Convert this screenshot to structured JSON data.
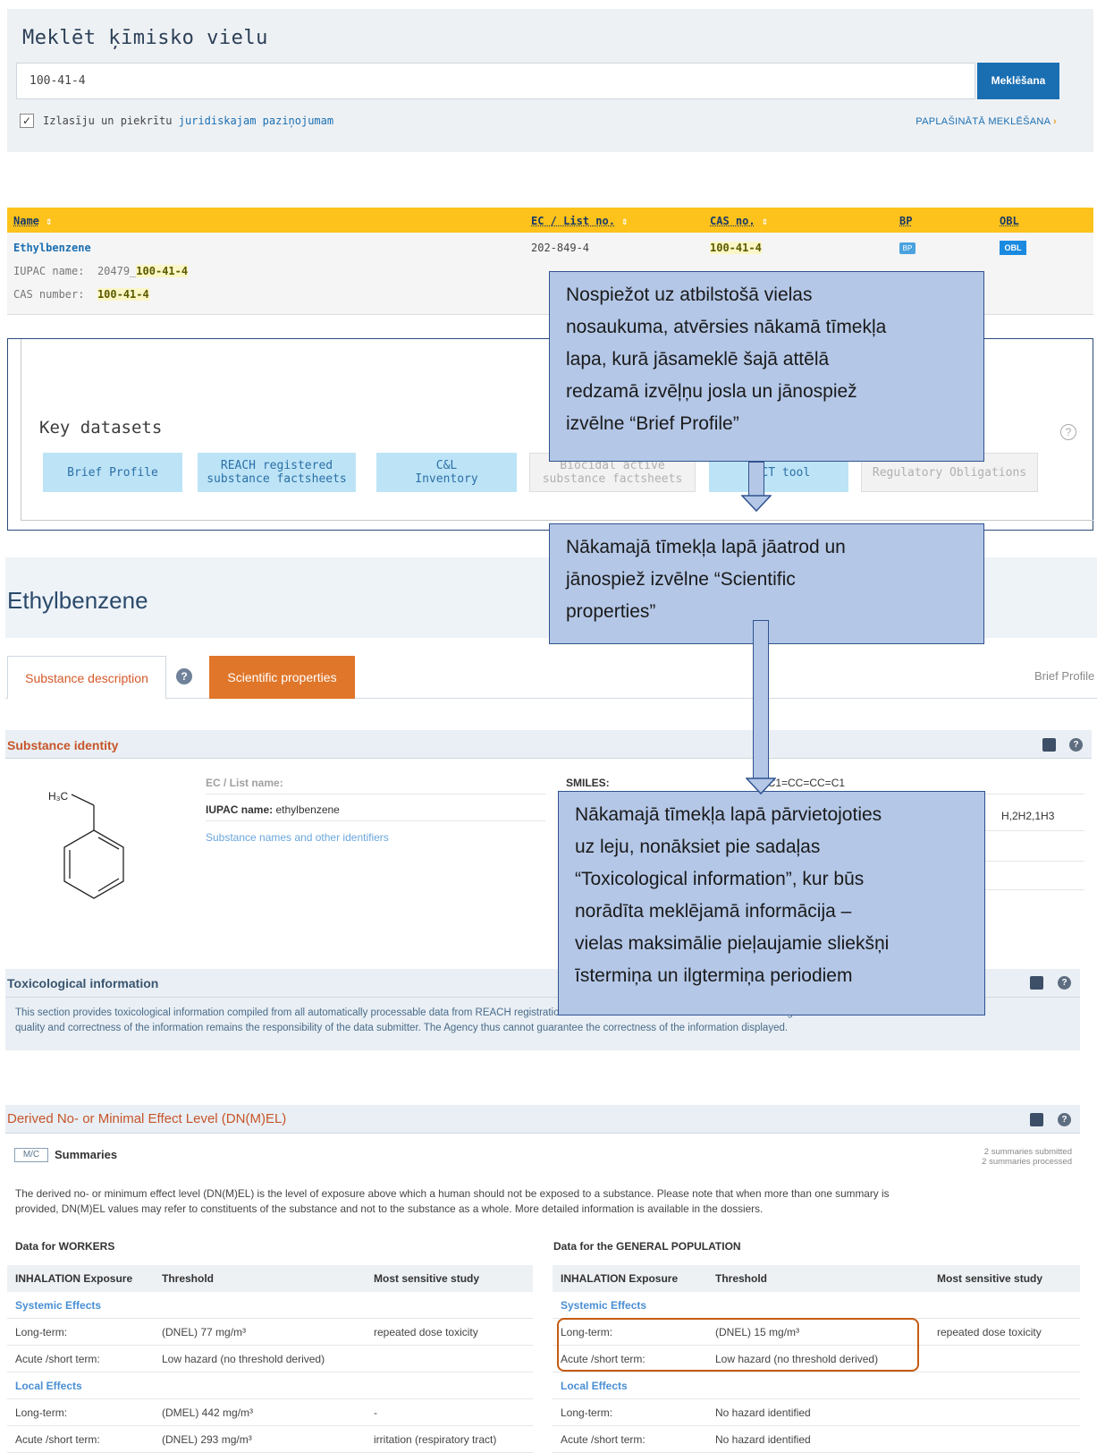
{
  "search": {
    "title": "Meklēt ķīmisko vielu",
    "value": "100-41-4",
    "button": "Meklēšana",
    "disclaimer_prefix": "Izlasīju un piekrītu ",
    "disclaimer_link": "juridiskajam paziņojumam",
    "advanced": "PAPLAŠINĀTĀ MEKLĒŠANA",
    "advanced_arrow": "›",
    "checkmark": "✓"
  },
  "results": {
    "columns": [
      "Name",
      "EC / List no.",
      "CAS no.",
      "BP",
      "OBL"
    ],
    "sort_icon": "⇕",
    "row": {
      "name": "Ethylbenzene",
      "iupac_label": "IUPAC name:",
      "iupac_prefix": "20479_",
      "iupac_highlight": "100-41-4",
      "cas_label": "CAS number:",
      "cas_value": "100-41-4",
      "ec": "202-849-4",
      "cas": "100-41-4",
      "bp": "BP",
      "obl": "OBL"
    }
  },
  "key_datasets": {
    "title": "Key datasets",
    "help": "?",
    "buttons": [
      {
        "line1": "Brief Profile",
        "line2": "",
        "active": true
      },
      {
        "line1": "REACH registered",
        "line2": "substance factsheets",
        "active": true
      },
      {
        "line1": "C&L",
        "line2": "Inventory",
        "active": true
      },
      {
        "line1": "Biocidal active",
        "line2": "substance factsheets",
        "active": false
      },
      {
        "line1": "PACT tool",
        "line2": "",
        "active": true
      },
      {
        "line1": "Regulatory Obligations",
        "line2": "",
        "active": false
      }
    ]
  },
  "substance": {
    "title": "Ethylbenzene",
    "tab_description": "Substance description",
    "tab_help": "?",
    "tab_scientific": "Scientific properties",
    "right_label": "Brief Profile"
  },
  "identity": {
    "title": "Substance identity",
    "formula_label": "H₃C",
    "ec_list_name_label": "EC / List name:",
    "iupac_label": "IUPAC name:",
    "iupac_value": "ethylbenzene",
    "names_link": "Substance names and other identifiers",
    "smiles_label": "SMILES:",
    "smiles_value": "CC1=CC=CC=C1",
    "inchi_fragment": "H,2H2,1H3"
  },
  "tox": {
    "title": "Toxicological information",
    "text_line1": "This section provides toxicological information compiled from all automatically processable data from REACH registration dossiers that is available to ECHA at the time of generation. The",
    "text_line2": "quality and correctness of the information remains the responsibility of the data submitter. The Agency thus cannot guarantee the correctness of the information displayed."
  },
  "dnel": {
    "title": "Derived No- or Minimal Effect Level (DN(M)EL)",
    "mc_badge": "M/C",
    "summaries_label": "Summaries",
    "submitted": "2 summaries submitted",
    "processed": "2 summaries processed",
    "desc_line1": "The derived no- or minimum effect level (DN(M)EL) is the level of exposure above which a human should not be exposed to a substance. Please note that when more than one summary is",
    "desc_line2": "provided, DN(M)EL values may refer to constituents of the substance and not to the substance as a whole. More detailed information is available in the dossiers.",
    "workers": {
      "title": "Data for WORKERS",
      "headers": [
        "INHALATION Exposure",
        "Threshold",
        "Most sensitive study"
      ],
      "systemic": "Systemic Effects",
      "local": "Local Effects",
      "rows": [
        [
          "Long-term:",
          "(DNEL) 77 mg/m³",
          "repeated dose toxicity"
        ],
        [
          "Acute /short term:",
          "Low hazard (no threshold derived)",
          ""
        ],
        [
          "Long-term:",
          "(DMEL) 442 mg/m³",
          "-"
        ],
        [
          "Acute /short term:",
          "(DNEL) 293 mg/m³",
          "irritation (respiratory tract)"
        ]
      ]
    },
    "general": {
      "title": "Data for the GENERAL POPULATION",
      "headers": [
        "INHALATION Exposure",
        "Threshold",
        "Most sensitive study"
      ],
      "systemic": "Systemic Effects",
      "local": "Local Effects",
      "rows": [
        [
          "Long-term:",
          "(DNEL) 15 mg/m³",
          "repeated dose toxicity"
        ],
        [
          "Acute /short term:",
          "Low hazard (no threshold derived)",
          ""
        ],
        [
          "Long-term:",
          "No hazard identified",
          ""
        ],
        [
          "Acute /short term:",
          "No hazard identified",
          ""
        ]
      ]
    }
  },
  "callouts": {
    "c1": [
      "Nospiežot uz atbilstošā vielas",
      "nosaukuma, atvērsies nākamā tīmekļa",
      "lapa, kurā jāsameklē šajā attēlā",
      "redzamā izvēļņu josla un jānospiež",
      "izvēlne “Brief Profile”"
    ],
    "c2": [
      "Nākamajā tīmekļa lapā jāatrod un",
      "jānospiež izvēlne “Scientific",
      "properties”"
    ],
    "c3": [
      "Nākamajā tīmekļa lapā pārvietojoties",
      "uz leju, nonāksiet pie sadaļas",
      "“Toxicological information”, kur būs",
      "norādīta meklējamā informācija –",
      "vielas maksimālie pieļaujamie sliekšņi",
      "īstermiņa un ilgtermiņa periodiem"
    ]
  },
  "colors": {
    "accent_blue": "#1a6fb3",
    "results_header": "#fdc21b",
    "tab_active": "#e0762a",
    "section_title": "#c7552a",
    "callout_fill": "#b4c7e7",
    "callout_border": "#2f528f",
    "highlight_box": "#c55a11"
  }
}
